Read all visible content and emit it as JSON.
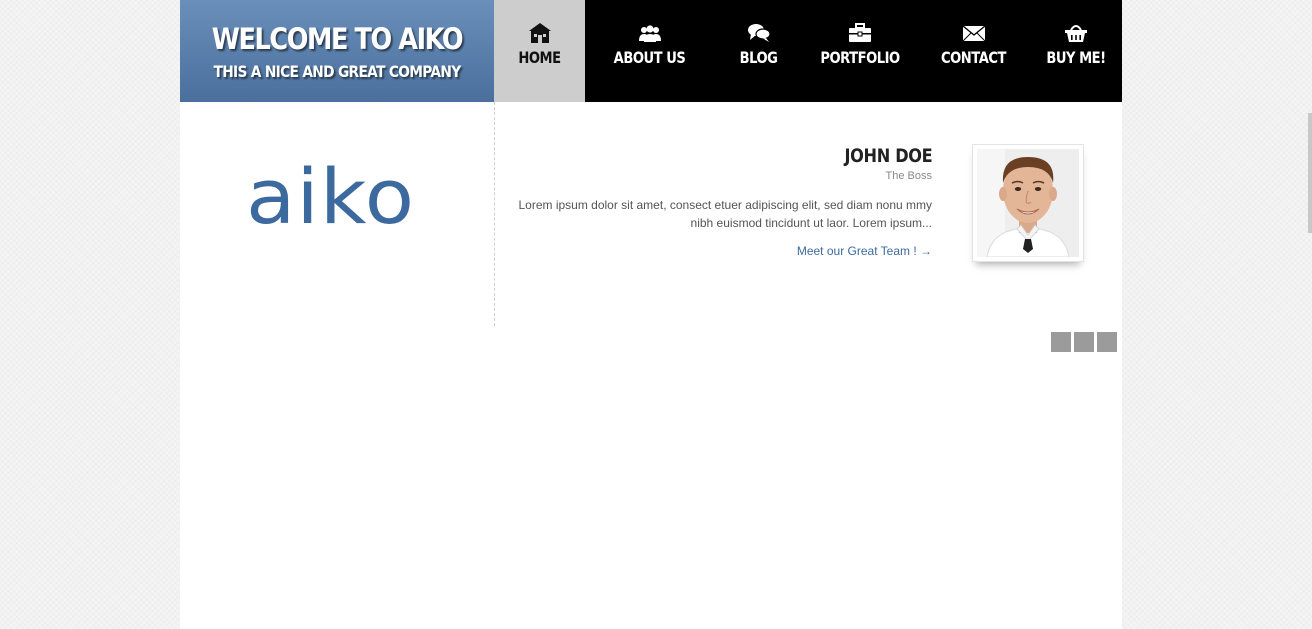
{
  "header": {
    "title": "WELCOME TO AIKO",
    "subtitle": "THIS A NICE AND GREAT COMPANY"
  },
  "nav": {
    "items": [
      {
        "label": "HOME",
        "icon": "home-icon",
        "active": true
      },
      {
        "label": "ABOUT US",
        "icon": "users-icon",
        "active": false
      },
      {
        "label": "BLOG",
        "icon": "chat-icon",
        "active": false
      },
      {
        "label": "PORTFOLIO",
        "icon": "briefcase-icon",
        "active": false
      },
      {
        "label": "CONTACT",
        "icon": "envelope-icon",
        "active": false
      },
      {
        "label": "BUY ME!",
        "icon": "basket-icon",
        "active": false
      }
    ]
  },
  "logo": {
    "text": "aiko"
  },
  "featured": {
    "name": "JOHN DOE",
    "role": "The Boss",
    "description": "Lorem ipsum dolor sit amet, consect etuer adipiscing elit, sed diam nonu mmy nibh euismod tincidunt ut laor. Lorem ipsum...",
    "link_text": "Meet our Great Team ! →",
    "photo": "person-photo"
  },
  "slider": {
    "dots": 3
  },
  "colors": {
    "accent": "#3d6a9e",
    "header_blue": "#4a6f9c",
    "nav_bg": "#000000",
    "nav_active_bg": "#cdcdcd",
    "slider_dot": "#9b9b9b"
  }
}
